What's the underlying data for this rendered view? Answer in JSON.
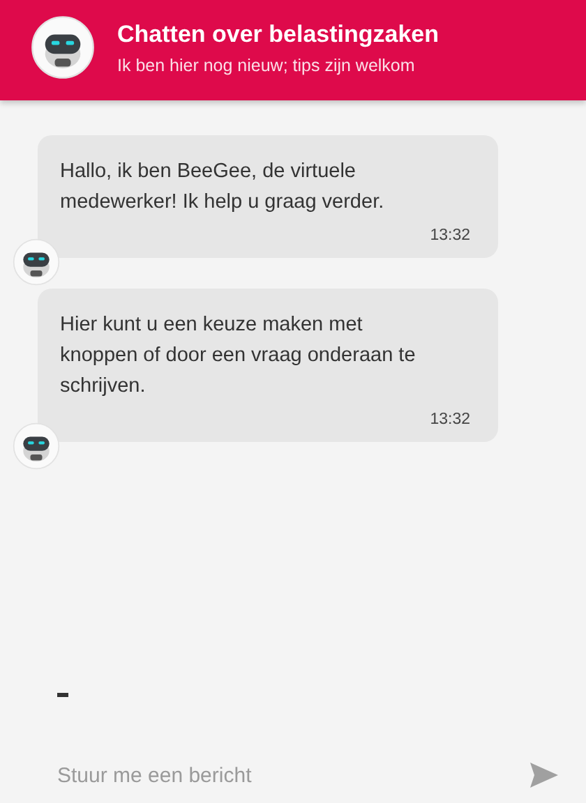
{
  "header": {
    "title": "Chatten over belastingzaken",
    "subtitle": "Ik ben hier nog nieuw; tips zijn welkom"
  },
  "messages": [
    {
      "text": "Hallo, ik ben BeeGee, de virtuele medewerker! Ik help u graag verder.",
      "time": "13:32"
    },
    {
      "text": "Hier kunt u een keuze maken met knoppen of door een vraag onderaan te schrijven.",
      "time": "13:32"
    }
  ],
  "typing": true,
  "composer": {
    "placeholder": "Stuur me een bericht"
  }
}
